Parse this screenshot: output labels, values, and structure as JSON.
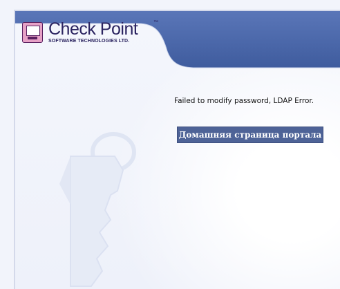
{
  "header": {
    "logo": {
      "name": "Check Point",
      "trademark": "™",
      "subtitle": "SOFTWARE TECHNOLOGIES LTD."
    },
    "banner_color": "#4a69ad"
  },
  "main": {
    "message": "Failed to modify password, LDAP Error.",
    "portal_button_label": "Домашняя страница портала"
  },
  "colors": {
    "button_bg": "#4e6397",
    "page_bg": "#f2f4fb"
  },
  "icons": {
    "logo": "check-point-computer-icon",
    "watermark": "key-icon"
  }
}
